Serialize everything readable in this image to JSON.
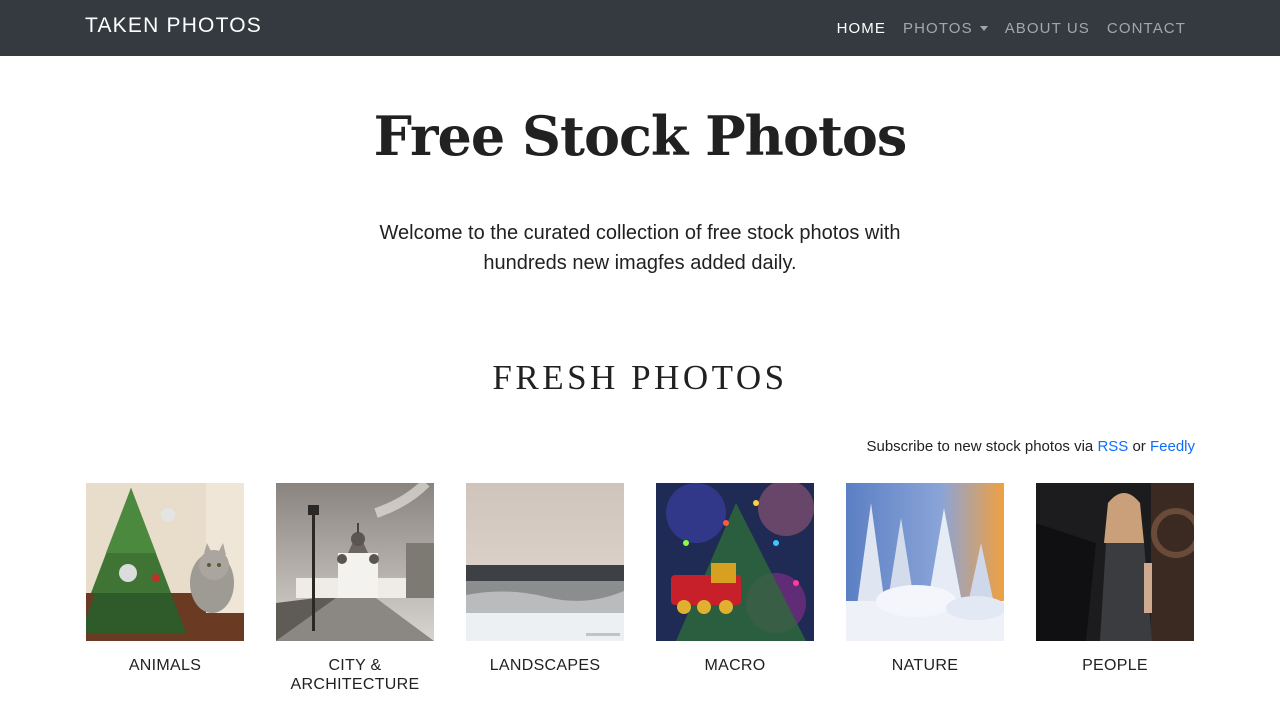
{
  "navbar": {
    "brand": "TAKEN PHOTOS",
    "links": [
      {
        "label": "HOME",
        "active": true
      },
      {
        "label": "PHOTOS",
        "dropdown": true
      },
      {
        "label": "ABOUT US"
      },
      {
        "label": "CONTACT"
      }
    ]
  },
  "hero": {
    "title": "Free Stock Photos",
    "text": "Welcome to the curated collection of free stock photos with hundreds new imagfes added daily."
  },
  "section": {
    "title": "FRESH PHOTOS",
    "subscribe_prefix": "Subscribe to new stock photos via",
    "rss_label": "RSS",
    "or_text": "or",
    "feedly_label": "Feedly"
  },
  "categories": [
    {
      "label": "ANIMALS",
      "image": "cat-and-christmas-tree-photo"
    },
    {
      "label": "CITY & ARCHITECTURE",
      "image": "monastery-street-photo"
    },
    {
      "label": "LANDSCAPES",
      "image": "winter-field-photo"
    },
    {
      "label": "MACRO",
      "image": "christmas-toy-train-photo"
    },
    {
      "label": "NATURE",
      "image": "snowy-forest-sunset-photo"
    },
    {
      "label": "PEOPLE",
      "image": "woman-portrait-photo"
    }
  ],
  "colors": {
    "navbar_bg": "#343a40",
    "link_blue": "#0d6efd",
    "text": "#212121"
  }
}
